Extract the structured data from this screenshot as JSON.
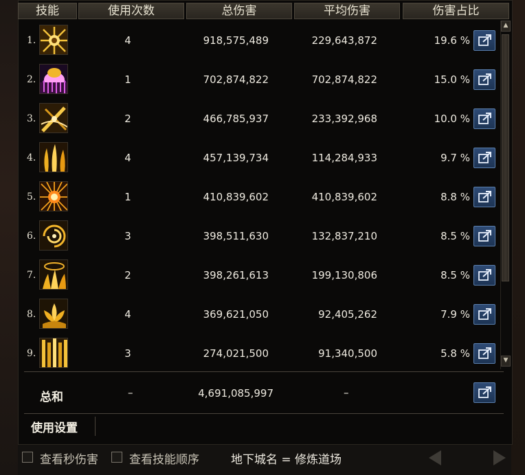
{
  "headers": {
    "skill": "技能",
    "uses": "使用次数",
    "total_damage": "总伤害",
    "avg_damage": "平均伤害",
    "share": "伤害占比"
  },
  "rows": [
    {
      "rank": "1.",
      "icon": "sun-burst-skill-icon",
      "uses": "4",
      "total": "918,575,489",
      "avg": "229,643,872",
      "pct": "19.6 %"
    },
    {
      "rank": "2.",
      "icon": "purple-dome-skill-icon",
      "uses": "1",
      "total": "702,874,822",
      "avg": "702,874,822",
      "pct": "15.0 %"
    },
    {
      "rank": "3.",
      "icon": "crossed-slash-skill-icon",
      "uses": "2",
      "total": "466,785,937",
      "avg": "233,392,968",
      "pct": "10.0 %"
    },
    {
      "rank": "4.",
      "icon": "flame-pillars-skill-icon",
      "uses": "4",
      "total": "457,139,734",
      "avg": "114,284,933",
      "pct": "9.7 %"
    },
    {
      "rank": "5.",
      "icon": "explosion-skill-icon",
      "uses": "1",
      "total": "410,839,602",
      "avg": "410,839,602",
      "pct": "8.8 %"
    },
    {
      "rank": "6.",
      "icon": "vortex-skill-icon",
      "uses": "3",
      "total": "398,511,630",
      "avg": "132,837,210",
      "pct": "8.5 %"
    },
    {
      "rank": "7.",
      "icon": "rising-flames-skill-icon",
      "uses": "2",
      "total": "398,261,613",
      "avg": "199,130,806",
      "pct": "8.5 %"
    },
    {
      "rank": "8.",
      "icon": "lotus-flame-skill-icon",
      "uses": "4",
      "total": "369,621,050",
      "avg": "92,405,262",
      "pct": "7.9 %"
    },
    {
      "rank": "9.",
      "icon": "light-columns-skill-icon",
      "uses": "3",
      "total": "274,021,500",
      "avg": "91,340,500",
      "pct": "5.8 %"
    }
  ],
  "total": {
    "label": "总和",
    "uses": "–",
    "value": "4,691,085,997",
    "avg": "–"
  },
  "settings_tab": "使用设置",
  "bottom": {
    "per_second_label": "查看秒伤害",
    "skill_order_label": "查看技能顺序",
    "dungeon_label": "地下城名 = 修炼道场"
  },
  "colors": {
    "share_button": "#2e4a74",
    "gold": "#f2b221"
  }
}
